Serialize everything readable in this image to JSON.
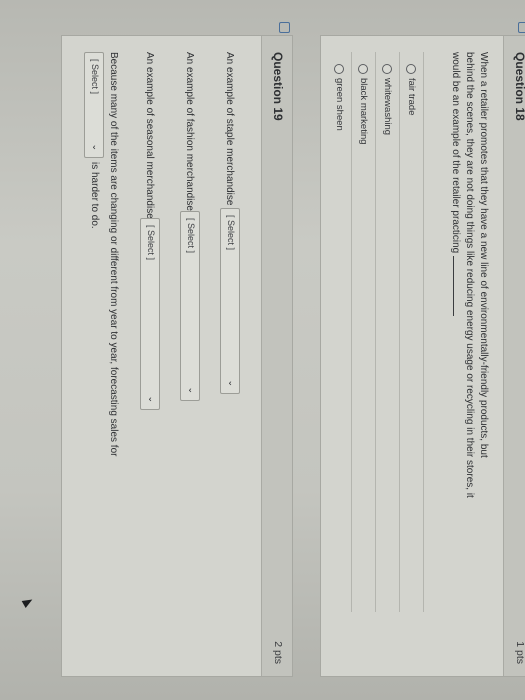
{
  "question18": {
    "title": "Question 18",
    "points": "1 pts",
    "prompt_line1": "When a retailer promotes that they have a new line of environmentally-friendly products, but",
    "prompt_line2": "behind the scenes, they are not doing things like reducing energy usage or recycling in their stores, it",
    "prompt_line3": "would be an example of the retailer practicing",
    "choices": [
      {
        "label": "fair trade"
      },
      {
        "label": "whitewashing"
      },
      {
        "label": "black marketing"
      },
      {
        "label": "green sheen"
      }
    ]
  },
  "question19": {
    "title": "Question 19",
    "points": "2 pts",
    "items": [
      {
        "text": "An example of staple merchandise would be",
        "select": "[ Select ]"
      },
      {
        "text": "An example of fashion merchandise would be",
        "select": "[ Select ]"
      },
      {
        "text": "An example of seasonal merchandise would be",
        "select": "[ Select ]"
      }
    ],
    "last_line": "Because many of the items are changing or different from year to year, forecasting sales for",
    "last_select": "[ Select ]",
    "last_suffix": "is harder to do."
  }
}
